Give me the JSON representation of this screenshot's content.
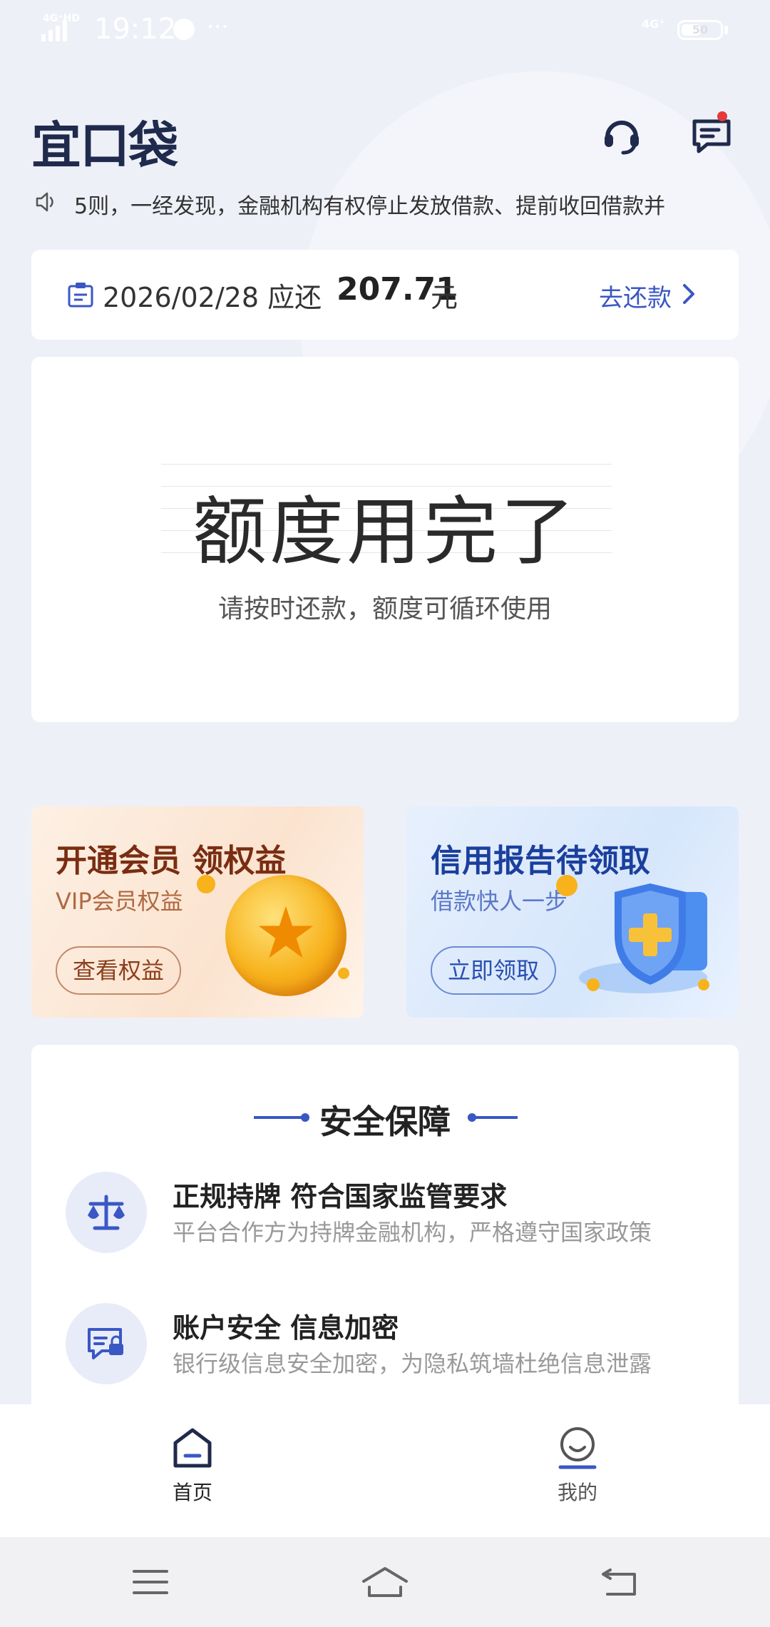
{
  "status_bar": {
    "network_left": "4G⁺HD",
    "time": "19:12",
    "dots": "···",
    "network_right": "4G⁺",
    "battery_level": "50"
  },
  "header": {
    "logo": "宜口袋",
    "has_unread_message": true
  },
  "notice": {
    "text": "5则，一经发现，金融机构有权停止发放借款、提前收回借款并"
  },
  "repayment": {
    "date_prefix": "2026/02/28 应还",
    "amount": "207.71",
    "unit": "元",
    "action_label": "去还款"
  },
  "quota": {
    "title": "额度用完了",
    "subtitle": "请按时还款，额度可循环使用"
  },
  "promos": [
    {
      "title": "开通会员 领权益",
      "subtitle": "VIP会员权益",
      "button": "查看权益"
    },
    {
      "title": "信用报告待领取",
      "subtitle": "借款快人一步",
      "button": "立即领取"
    }
  ],
  "security": {
    "title": "安全保障",
    "items": [
      {
        "title": "正规持牌 符合国家监管要求",
        "desc": "平台合作方为持牌金融机构，严格遵守国家政策",
        "icon": "scale-icon"
      },
      {
        "title": "账户安全 信息加密",
        "desc": "银行级信息安全加密，为隐私筑墙杜绝信息泄露",
        "icon": "secure-card-icon"
      }
    ]
  },
  "tabs": [
    {
      "label": "首页",
      "icon": "home-icon",
      "active": true
    },
    {
      "label": "我的",
      "icon": "profile-icon",
      "active": false
    }
  ],
  "colors": {
    "accent": "#3a57c4",
    "brand_dark": "#1f2a4c",
    "background": "#eef0f8",
    "alert": "#e53a3a"
  }
}
